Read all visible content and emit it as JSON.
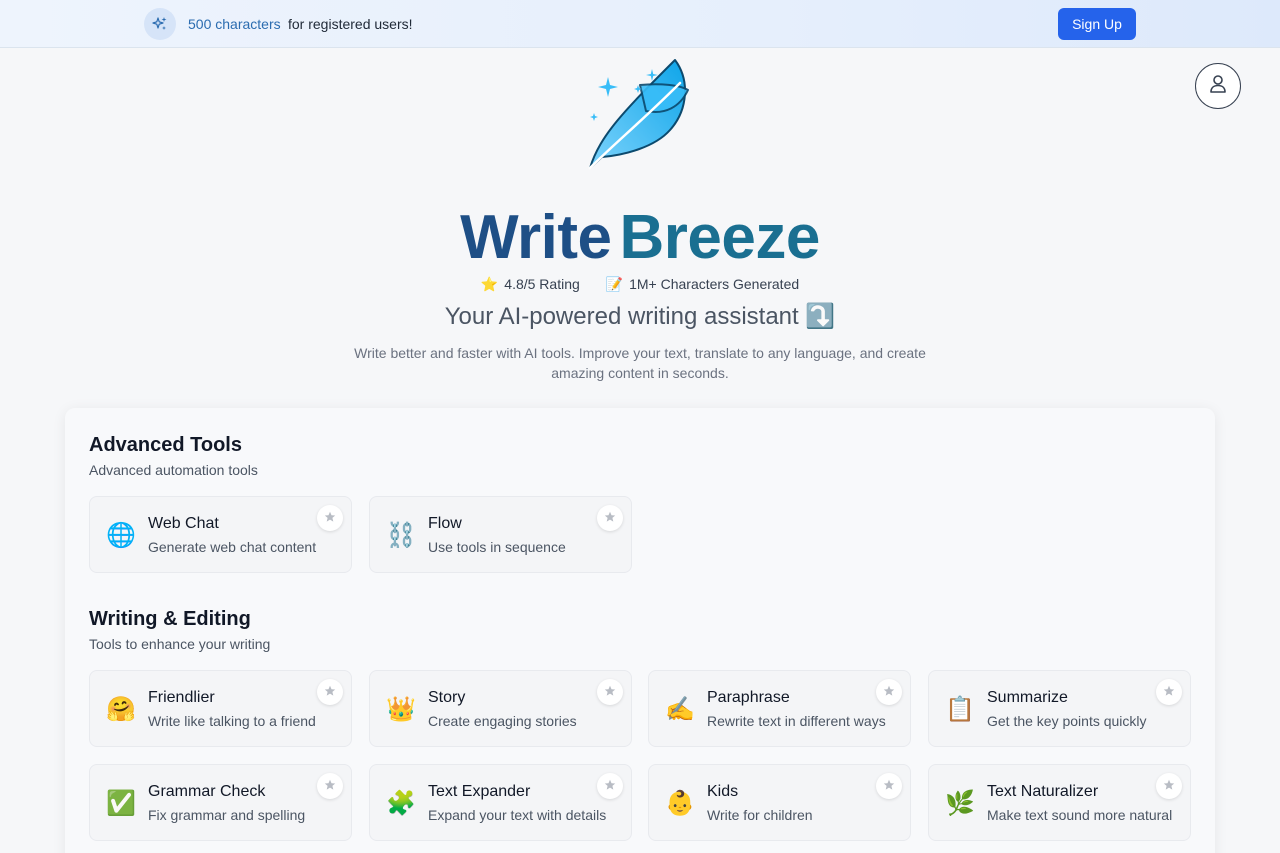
{
  "banner": {
    "highlight": "500 characters",
    "text": "for registered users!",
    "signup_label": "Sign Up",
    "icon": "sparkles-icon"
  },
  "profile": {
    "icon": "user-icon"
  },
  "hero": {
    "logo_icon": "feather-logo-icon",
    "brand_part1": "Write",
    "brand_part2": "Breeze",
    "rating_emoji": "⭐",
    "rating": "4.8/5 Rating",
    "chars_emoji": "📝",
    "chars": "1M+ Characters Generated",
    "tagline": "Your AI-powered writing assistant ⤵️",
    "description": "Write better and faster with AI tools. Improve your text, translate to any language, and create amazing content in seconds."
  },
  "sections": [
    {
      "title": "Advanced Tools",
      "subtitle": "Advanced automation tools",
      "tools": [
        {
          "emoji": "🌐",
          "name": "Web Chat",
          "desc": "Generate web chat content"
        },
        {
          "emoji": "⛓️",
          "name": "Flow",
          "desc": "Use tools in sequence"
        }
      ]
    },
    {
      "title": "Writing & Editing",
      "subtitle": "Tools to enhance your writing",
      "tools": [
        {
          "emoji": "🤗",
          "name": "Friendlier",
          "desc": "Write like talking to a friend"
        },
        {
          "emoji": "👑",
          "name": "Story",
          "desc": "Create engaging stories"
        },
        {
          "emoji": "✍️",
          "name": "Paraphrase",
          "desc": "Rewrite text in different ways"
        },
        {
          "emoji": "📋",
          "name": "Summarize",
          "desc": "Get the key points quickly"
        },
        {
          "emoji": "✅",
          "name": "Grammar Check",
          "desc": "Fix grammar and spelling"
        },
        {
          "emoji": "🧩",
          "name": "Text Expander",
          "desc": "Expand your text with details"
        },
        {
          "emoji": "👶",
          "name": "Kids",
          "desc": "Write for children"
        },
        {
          "emoji": "🌿",
          "name": "Text Naturalizer",
          "desc": "Make text sound more natural"
        }
      ]
    }
  ],
  "colors": {
    "accent": "#2563eb",
    "brand_dark": "#1e4f86",
    "brand_teal": "#1a6f91",
    "feather": "#38bdf8"
  }
}
